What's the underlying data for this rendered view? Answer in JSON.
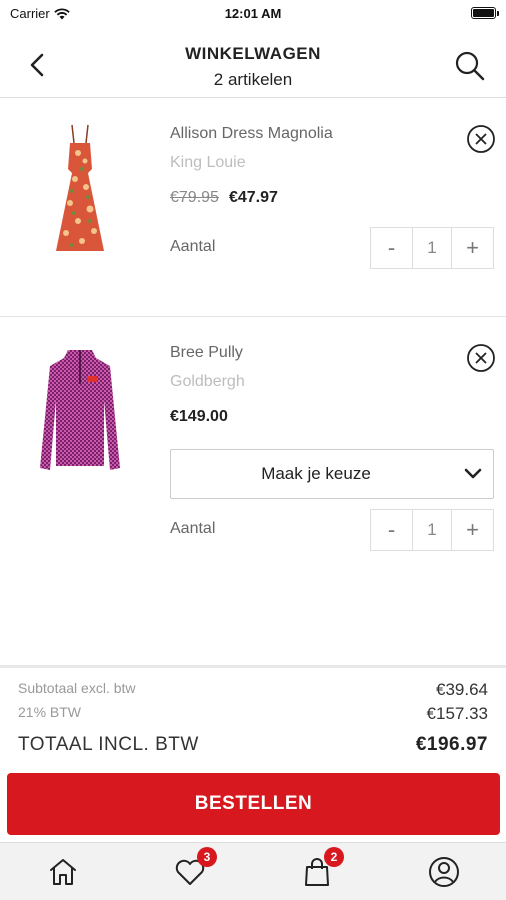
{
  "status_bar": {
    "carrier": "Carrier",
    "time": "12:01 AM"
  },
  "header": {
    "title": "WINKELWAGEN",
    "subtitle": "2 artikelen"
  },
  "cart_items": [
    {
      "name": "Allison Dress Magnolia",
      "brand": "King Louie",
      "old_price": "€79.95",
      "price": "€47.97",
      "quantity_label": "Aantal",
      "quantity": "1",
      "decrement": "-",
      "increment": "+"
    },
    {
      "name": "Bree Pully",
      "brand": "Goldbergh",
      "price": "€149.00",
      "size_select": "Maak je keuze",
      "quantity_label": "Aantal",
      "quantity": "1",
      "decrement": "-",
      "increment": "+"
    }
  ],
  "totals": {
    "subtotal_label": "Subtotaal excl. btw",
    "subtotal_value": "€39.64",
    "vat_label": "21% BTW",
    "vat_value": "€157.33",
    "total_label": "TOTAAL INCL. BTW",
    "total_value": "€196.97"
  },
  "order_button": "BESTELLEN",
  "tabbar": {
    "wishlist_count": "3",
    "cart_count": "2"
  },
  "colors": {
    "accent": "#d7191f",
    "text": "#222222",
    "muted": "#bdbdbd",
    "tabbar_bg": "#f2f2f2"
  },
  "icons": [
    "back-arrow-icon",
    "search-icon",
    "close-circle-icon",
    "chevron-down-icon",
    "home-icon",
    "heart-icon",
    "shopping-bag-icon",
    "account-icon"
  ]
}
